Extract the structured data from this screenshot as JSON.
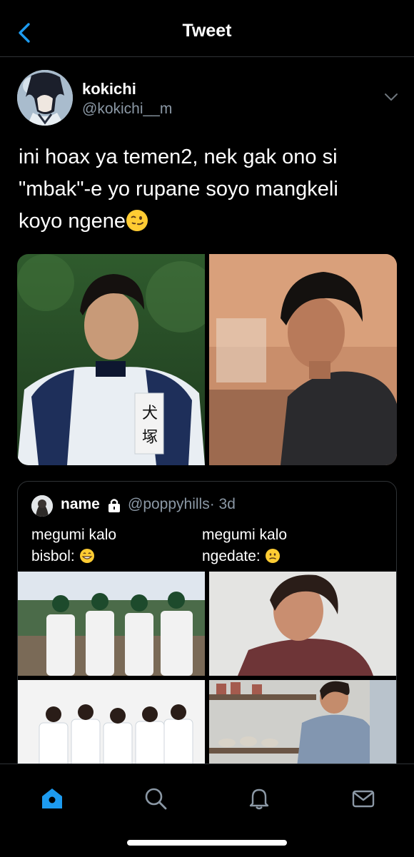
{
  "header": {
    "title": "Tweet",
    "back_icon": "chevron-left-icon"
  },
  "tweet": {
    "author_name": "kokichi",
    "author_handle": "@kokichi__m",
    "text_line1": "ini hoax ya temen2, nek gak ono si",
    "text_line2": "\"mbak\"-e yo rupane soyo mangkeli",
    "text_line3": "koyo ngene",
    "text_emoji": "winking-smirk-emoji"
  },
  "quote": {
    "name": "name",
    "handle": "@poppyhills",
    "time": "· 3d",
    "left_line1": "megumi kalo",
    "left_line2": "bisbol:",
    "right_line1": "megumi kalo",
    "right_line2": "ngedate:"
  },
  "tabs": [
    "home-icon",
    "search-icon",
    "notifications-icon",
    "messages-icon"
  ],
  "colors": {
    "accent": "#1d9bf0",
    "background": "#000000",
    "muted": "#8b98a5",
    "border": "#2f3336"
  }
}
